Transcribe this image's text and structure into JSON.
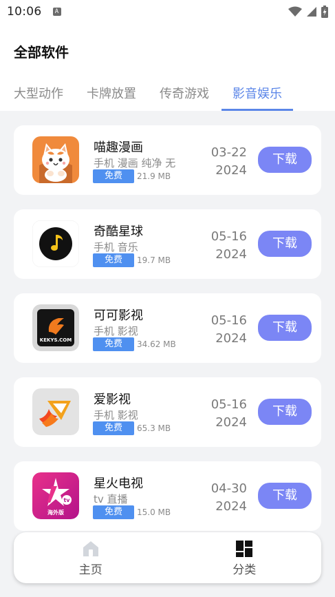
{
  "status_bar": {
    "time": "10:06",
    "notification_glyph": "A"
  },
  "header": {
    "title": "全部软件"
  },
  "tabs": [
    {
      "label": "大型动作",
      "active": false
    },
    {
      "label": "卡牌放置",
      "active": false
    },
    {
      "label": "传奇游戏",
      "active": false
    },
    {
      "label": "影音娱乐",
      "active": true
    }
  ],
  "apps": [
    {
      "name": "喵趣漫画",
      "tags": "手机 漫画 纯净 无",
      "badge": "免费",
      "size": "21.9 MB",
      "date_md": "03-22",
      "date_year": "2024",
      "download_label": "下载",
      "icon": "cartoon-cat-icon"
    },
    {
      "name": "奇酷星球",
      "tags": "手机 音乐",
      "badge": "免费",
      "size": "19.7 MB",
      "date_md": "05-16",
      "date_year": "2024",
      "download_label": "下载",
      "icon": "music-note-icon"
    },
    {
      "name": "可可影视",
      "tags": "手机 影视",
      "badge": "免费",
      "size": "34.62 MB",
      "date_md": "05-16",
      "date_year": "2024",
      "download_label": "下载",
      "icon": "kekys-logo-icon",
      "icon_text": "KEKYS.COM"
    },
    {
      "name": "爱影视",
      "tags": "手机 影视",
      "badge": "免费",
      "size": "65.3 MB",
      "date_md": "05-16",
      "date_year": "2024",
      "download_label": "下载",
      "icon": "flame-play-icon"
    },
    {
      "name": "星火电视",
      "tags": "tv 直播",
      "badge": "免费",
      "size": "15.0 MB",
      "date_md": "04-30",
      "date_year": "2024",
      "download_label": "下载",
      "icon": "star-tv-icon",
      "icon_text_tv": "tv",
      "icon_text_sub": "海外版"
    }
  ],
  "bottom_nav": {
    "home_label": "主页",
    "category_label": "分类"
  },
  "colors": {
    "accent": "#5b86e8",
    "download_button": "#7b86f5",
    "free_badge": "#4f90f0",
    "background": "#f2f3f5"
  }
}
